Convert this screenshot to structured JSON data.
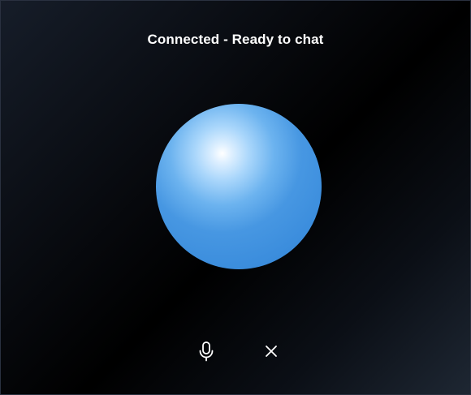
{
  "status": {
    "text": "Connected - Ready to chat"
  },
  "orb": {
    "color_primary": "#3a8cdc",
    "color_highlight": "#ffffff"
  },
  "controls": {
    "mic_icon": "microphone-icon",
    "close_icon": "close-icon",
    "icon_color": "#ffffff"
  },
  "theme": {
    "background": "#000000"
  }
}
